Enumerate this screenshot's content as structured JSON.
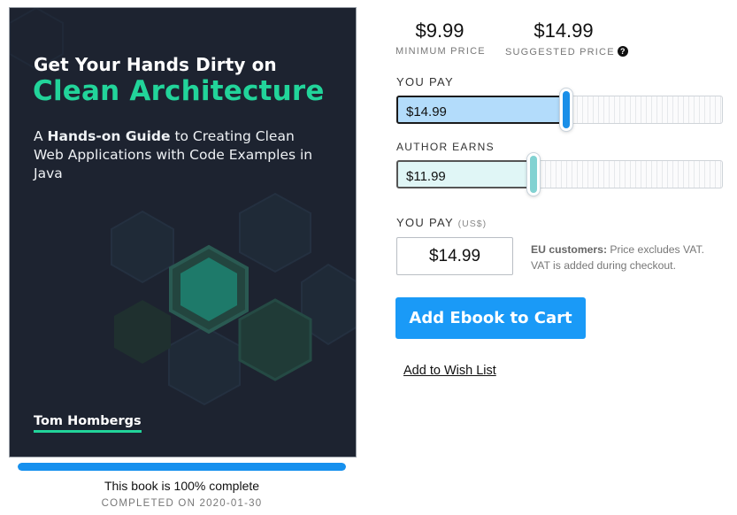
{
  "cover": {
    "title_line1": "Get Your Hands Dirty on",
    "title_line2": "Clean Architecture",
    "subtitle_prefix": "A ",
    "subtitle_bold": "Hands-on Guide",
    "subtitle_rest": " to Creating Clean Web Applications with Code Examples in Java",
    "author": "Tom Hombergs",
    "colors": {
      "background": "#1d2330",
      "accent": "#22d49a"
    }
  },
  "completion": {
    "progress_fraction": 1.0,
    "status_text": "This book is 100% complete",
    "completed_text": "COMPLETED ON 2020-01-30"
  },
  "pricing": {
    "minimum": {
      "amount": "$9.99",
      "label": "MINIMUM PRICE"
    },
    "suggested": {
      "amount": "$14.99",
      "label": "SUGGESTED PRICE",
      "icon": "question-circle-icon"
    },
    "you_pay_slider": {
      "label": "YOU PAY",
      "value": "$14.99",
      "level": 0.52,
      "fill_color": "#b3dcfb",
      "knob_color": "#1a8fe8"
    },
    "author_earns_slider": {
      "label": "AUTHOR EARNS",
      "value": "$11.99",
      "level": 0.42,
      "fill_color": "#e0f6f6",
      "knob_color": "#82d2d2"
    },
    "amount_field": {
      "label": "YOU PAY",
      "unit": "(US$)",
      "value": "$14.99"
    },
    "vat_note_bold": "EU customers:",
    "vat_note_line1": " Price excludes VAT.",
    "vat_note_line2": "VAT is added during checkout."
  },
  "actions": {
    "add_to_cart": "Add Ebook to Cart",
    "wishlist": "Add to Wish List"
  }
}
